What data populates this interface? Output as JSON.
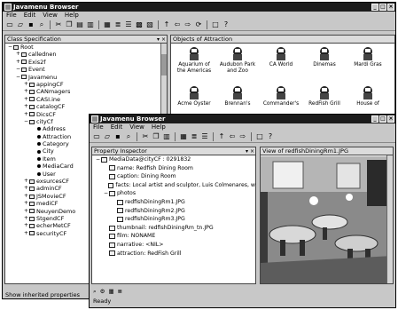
{
  "back_window": {
    "title": "Javamenu Browser",
    "menu": [
      "File",
      "Edit",
      "View",
      "Help"
    ],
    "left_pane_title": "Class Specification",
    "right_pane_title": "Objects of Attraction",
    "status": "Show inherited properties",
    "tree": [
      {
        "indent": 0,
        "glyph": "−",
        "label": "Root"
      },
      {
        "indent": 1,
        "glyph": "+",
        "label": "callednen"
      },
      {
        "indent": 1,
        "glyph": "+",
        "label": "Exis2f"
      },
      {
        "indent": 1,
        "glyph": "−",
        "label": "Event"
      },
      {
        "indent": 1,
        "glyph": "−",
        "label": "Javamenu"
      },
      {
        "indent": 2,
        "glyph": "+",
        "label": "appingCF"
      },
      {
        "indent": 2,
        "glyph": "+",
        "label": "CANmagers"
      },
      {
        "indent": 2,
        "glyph": "+",
        "label": "CASI.ine"
      },
      {
        "indent": 2,
        "glyph": "+",
        "label": "catalogCF"
      },
      {
        "indent": 2,
        "glyph": "+",
        "label": "DicsCF"
      },
      {
        "indent": 2,
        "glyph": "−",
        "label": "cityCf"
      },
      {
        "indent": 3,
        "glyph": "•",
        "label": "Address"
      },
      {
        "indent": 3,
        "glyph": "•",
        "label": "Attraction"
      },
      {
        "indent": 3,
        "glyph": "•",
        "label": "Category"
      },
      {
        "indent": 3,
        "glyph": "•",
        "label": "City"
      },
      {
        "indent": 3,
        "glyph": "•",
        "label": "Item"
      },
      {
        "indent": 3,
        "glyph": "•",
        "label": "MediaCard"
      },
      {
        "indent": 3,
        "glyph": "•",
        "label": "User"
      },
      {
        "indent": 2,
        "glyph": "+",
        "label": "exsurcesCF"
      },
      {
        "indent": 2,
        "glyph": "+",
        "label": "adminCF"
      },
      {
        "indent": 2,
        "glyph": "+",
        "label": "JSMovieCF"
      },
      {
        "indent": 2,
        "glyph": "+",
        "label": "mediCF"
      },
      {
        "indent": 2,
        "glyph": "+",
        "label": "NeuyenDemo"
      },
      {
        "indent": 2,
        "glyph": "+",
        "label": "StgendCF"
      },
      {
        "indent": 2,
        "glyph": "+",
        "label": "echerMetCF"
      },
      {
        "indent": 2,
        "glyph": "+",
        "label": "securityCF"
      }
    ],
    "objects": [
      {
        "label": "Aquarium of the Americas"
      },
      {
        "label": "Audubon Park and Zoo"
      },
      {
        "label": "CA World"
      },
      {
        "label": "Dinemas"
      },
      {
        "label": "Mardi Gras"
      },
      {
        "label": "Acme Oyster"
      },
      {
        "label": "Brennan's"
      },
      {
        "label": "Commander's"
      },
      {
        "label": "RedFish Grill"
      },
      {
        "label": "House of"
      }
    ]
  },
  "front_window": {
    "title": "Javamenu Browser",
    "menu": [
      "File",
      "Edit",
      "View",
      "Help"
    ],
    "left_pane_title": "Property Inspector",
    "right_pane_title": "View of redfishDiningRm1.JPG",
    "status": "Ready",
    "properties": [
      {
        "indent": 0,
        "glyph": "−",
        "text": "MediaData@cityCF : 0291832"
      },
      {
        "indent": 1,
        "glyph": "",
        "text": "name: Redfish Dining Room"
      },
      {
        "indent": 1,
        "glyph": "",
        "text": "caption: Dining Room"
      },
      {
        "indent": 1,
        "glyph": "",
        "text": "facts: Local artist and sculptor, Luis Colmenares, w"
      },
      {
        "indent": 1,
        "glyph": "−",
        "text": "photos"
      },
      {
        "indent": 2,
        "glyph": "",
        "text": "redfishDiningRm1.JPG"
      },
      {
        "indent": 2,
        "glyph": "",
        "text": "redfishDiningRm2.JPG"
      },
      {
        "indent": 2,
        "glyph": "",
        "text": "redfishDiningRm3.JPG"
      },
      {
        "indent": 1,
        "glyph": "",
        "text": "thumbnail: redfishDiningRm_tn.JPG"
      },
      {
        "indent": 1,
        "glyph": "",
        "text": "film: NONAME"
      },
      {
        "indent": 1,
        "glyph": "",
        "text": "narrative: <NIL>"
      },
      {
        "indent": 1,
        "glyph": "",
        "text": "attraction: RedFish Grill"
      }
    ]
  }
}
